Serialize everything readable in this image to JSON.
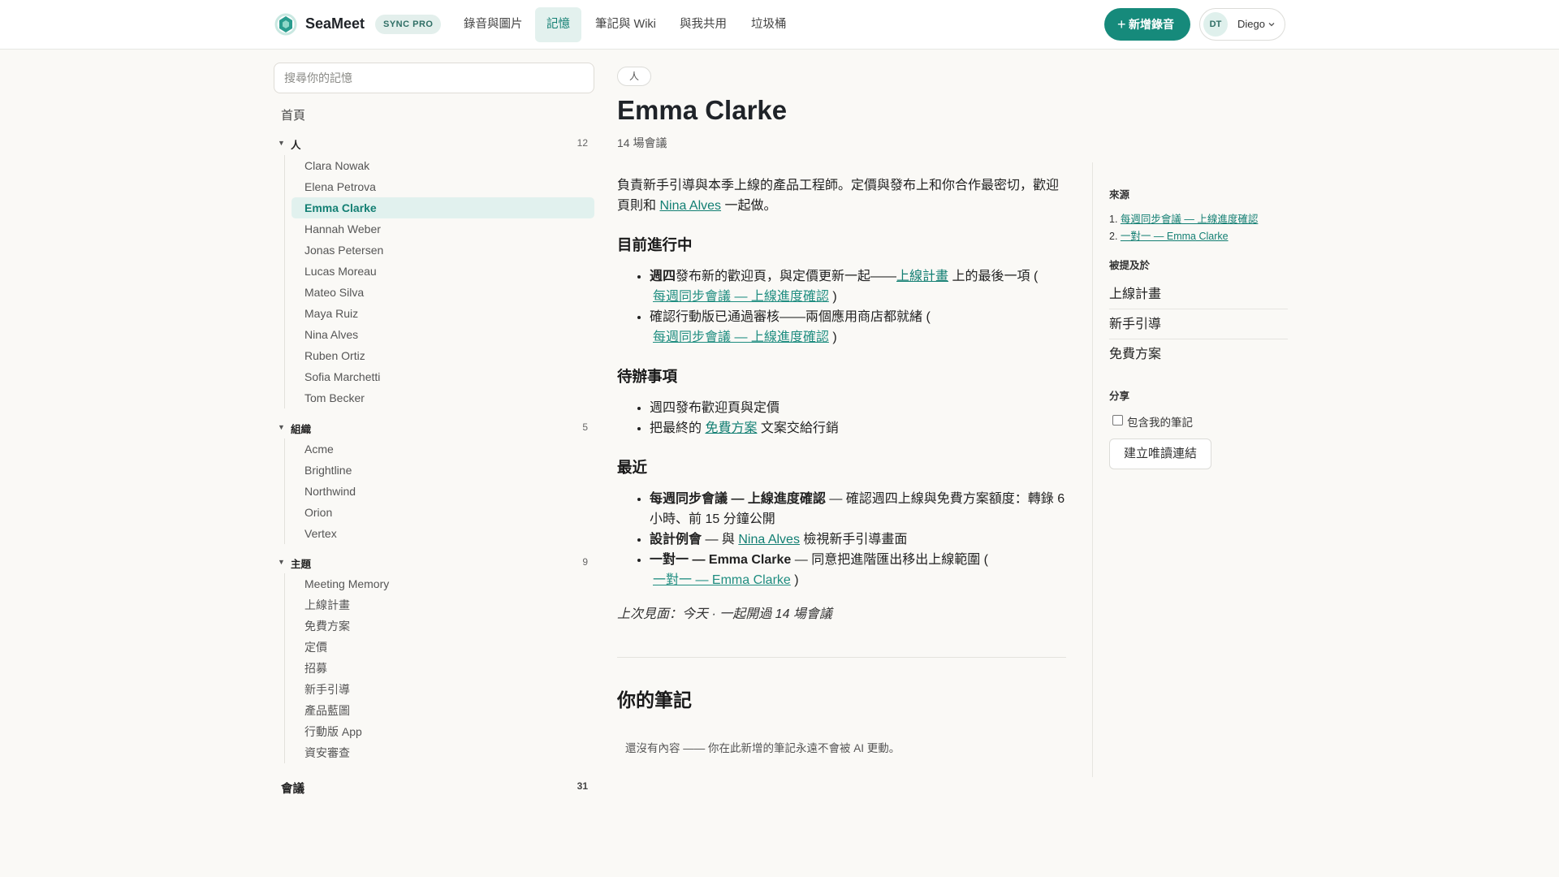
{
  "header": {
    "brand": "SeaMeet",
    "plan_badge": "SYNC PRO",
    "tabs": [
      {
        "label": "錄音與圖片"
      },
      {
        "label": "記憶"
      },
      {
        "label": "筆記與 Wiki"
      },
      {
        "label": "與我共用"
      },
      {
        "label": "垃圾桶"
      }
    ],
    "active_tab": "記憶",
    "new_recording_label": "新增錄音",
    "user": {
      "initials": "DT",
      "name": "Diego"
    },
    "accent_color": "#168a7b"
  },
  "sidebar": {
    "search_placeholder": "搜尋你的記憶",
    "home_label": "首頁",
    "people": {
      "title": "人",
      "count": "12",
      "items": [
        "Clara Nowak",
        "Elena Petrova",
        "Emma Clarke",
        "Hannah Weber",
        "Jonas Petersen",
        "Lucas Moreau",
        "Mateo Silva",
        "Maya Ruiz",
        "Nina Alves",
        "Ruben Ortiz",
        "Sofia Marchetti",
        "Tom Becker"
      ],
      "selected": "Emma Clarke"
    },
    "orgs": {
      "title": "組織",
      "count": "5",
      "items": [
        "Acme",
        "Brightline",
        "Northwind",
        "Orion",
        "Vertex"
      ]
    },
    "topics": {
      "title": "主題",
      "count": "9",
      "items": [
        "Meeting Memory",
        "上線計畫",
        "免費方案",
        "定價",
        "招募",
        "新手引導",
        "產品藍圖",
        "行動版 App",
        "資安審查"
      ]
    },
    "meetings": {
      "title": "會議",
      "count": "31"
    }
  },
  "main": {
    "type_chip": "人",
    "title": "Emma Clarke",
    "meeting_count": "14 場會議",
    "intro_before": "負責新手引導與本季上線的產品工程師。定價與發布上和你合作最密切，歡迎頁則和 ",
    "intro_link": "Nina Alves",
    "intro_after": " 一起做。",
    "in_progress": {
      "heading": "目前進行中",
      "item1_bold": "週四",
      "item1_text": "發布新的歡迎頁，與定價更新一起——",
      "item1_link": "上線計畫",
      "item1_after": " 上的最後一項 (",
      "item1_cite": "每週同步會議 — 上線進度確認",
      "item2_text": "確認行動版已通過審核——兩個應用商店都就緒 (",
      "item2_cite": "每週同步會議 — 上線進度確認",
      "close_paren": ")"
    },
    "todo": {
      "heading": "待辦事項",
      "item1": "週四發布歡迎頁與定價",
      "item2_before": "把最終的 ",
      "item2_link": "免費方案",
      "item2_after": " 文案交給行銷"
    },
    "recent": {
      "heading": "最近",
      "item1_bold": "每週同步會議 — 上線進度確認",
      "item1_text": " — 確認週四上線與免費方案額度：轉錄 6 小時、前 15 分鐘公開",
      "item2_bold": "設計例會",
      "item2_before": " — 與 ",
      "item2_link": "Nina Alves",
      "item2_after": " 檢視新手引導畫面",
      "item3_bold": "一對一 — Emma Clarke",
      "item3_text": " — 同意把進階匯出移出上線範圍 (",
      "item3_cite": "一對一 — Emma Clarke"
    },
    "last_seen": "上次見面：今天 · 一起開過 14 場會議",
    "notes_title": "你的筆記",
    "notes_empty": "還沒有內容 —— 你在此新增的筆記永遠不會被 AI 更動。"
  },
  "right_panel": {
    "sources_label": "來源",
    "sources": [
      "每週同步會議 — 上線進度確認",
      "一對一 — Emma Clarke"
    ],
    "mentioned_label": "被提及於",
    "mentioned": [
      "上線計畫",
      "新手引導",
      "免費方案"
    ],
    "share_label": "分享",
    "include_notes_label": "包含我的筆記",
    "include_notes_checked": false,
    "create_link_label": "建立唯讀連結"
  }
}
